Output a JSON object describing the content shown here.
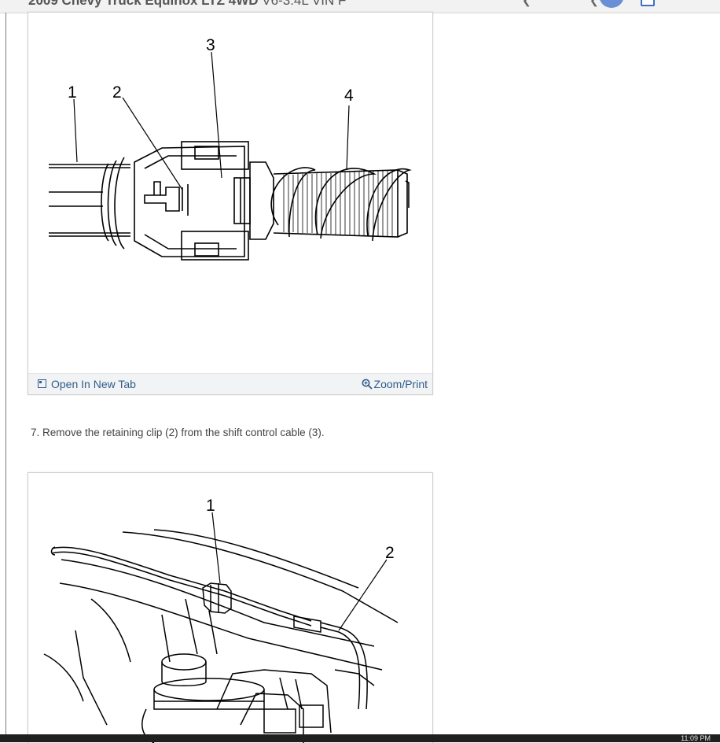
{
  "header": {
    "title": "2009 Chevy Truck Equinox LTZ 4WD",
    "title_suffix": "V6-3.4L VIN F"
  },
  "figure1": {
    "callouts": [
      "1",
      "2",
      "3",
      "4"
    ],
    "open_tab_label": "Open In New Tab",
    "zoom_label": "Zoom/Print"
  },
  "instruction": {
    "step_text": "7. Remove the retaining clip (2) from the shift control cable (3)."
  },
  "figure2": {
    "callouts": [
      "1",
      "2"
    ]
  },
  "taskbar": {
    "clock": "11:09 PM"
  }
}
